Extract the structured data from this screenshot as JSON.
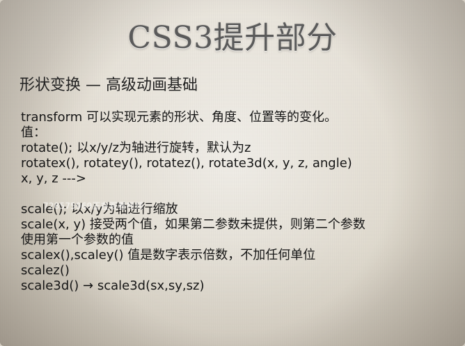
{
  "slide": {
    "title": "CSS3提升部分",
    "subtitle": "形状变换   —    高级动画基础",
    "lines": [
      "transform  可以实现元素的形状、角度、位置等的变化。",
      "值：",
      "rotate(); 以x/y/z为轴进行旋转，默认为z",
      "rotatex(), rotatey(), rotatez(), rotate3d(x, y, z, angle)",
      "x, y, z --->",
      "",
      "scale(); 以x/y为轴进行缩放",
      "scale(x, y) 接受两个值，如果第二参数未提供，则第二个参数",
      "使用第一个参数的值",
      "scalex(),scaley() 值是数字表示倍数，不加任何单位",
      "scalez()",
      "scale3d() → scale3d(sx,sy,sz)"
    ],
    "watermark": "728575969正在观看视频"
  }
}
